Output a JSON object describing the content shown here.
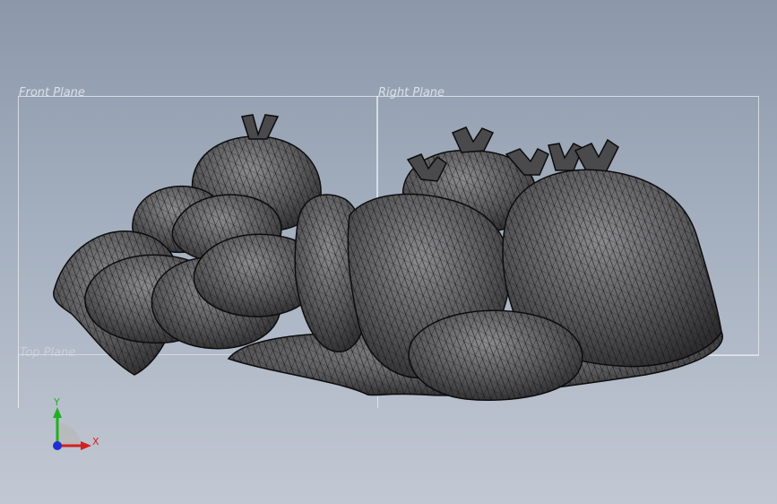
{
  "viewport": {
    "planes": {
      "front_label": "Front Plane",
      "right_label": "Right Plane",
      "top_label": "Top Plane"
    },
    "model": {
      "name": "mesh-model",
      "shade_color": "#5a5a5c",
      "mesh_color": "#111111"
    },
    "triad": {
      "x_label": "X",
      "y_label": "Y",
      "x_color": "#d42020",
      "y_color": "#20b020",
      "z_color": "#2030d0"
    }
  }
}
